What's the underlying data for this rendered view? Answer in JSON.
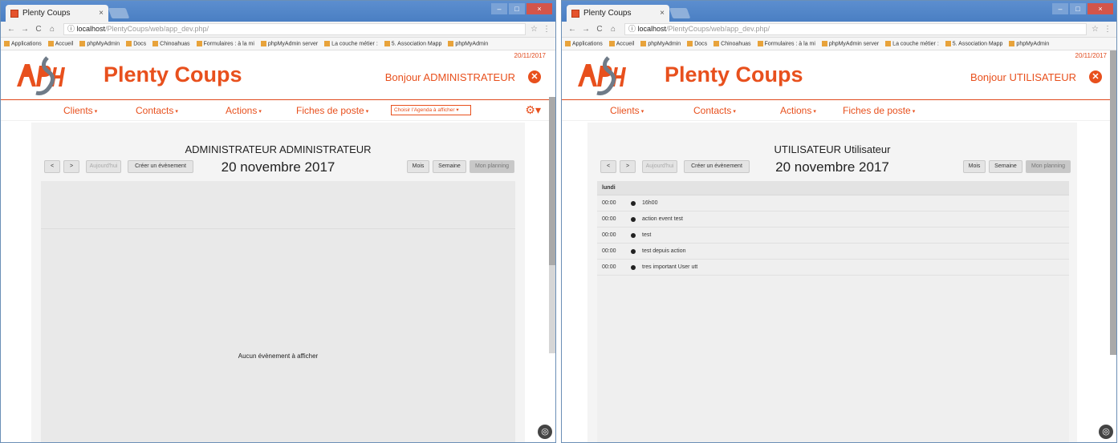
{
  "windows": [
    {
      "browser": {
        "tab_title": "Plenty Coups",
        "tab_close": "×",
        "url_host": "localhost",
        "url_path": "/PlentyCoups/web/app_dev.php/",
        "controls": [
          "–",
          "□",
          "×"
        ],
        "bookmarks": [
          "Applications",
          "Accueil",
          "phpMyAdmin",
          "Docs",
          "Chinoahuas",
          "Formulaires : à la mi",
          "phpMyAdmin server",
          "La couche métier :",
          "5. Association Mapp",
          "phpMyAdmin"
        ]
      },
      "site": {
        "date": "20/11/2017",
        "brand": "Plenty Coups",
        "greeting": "Bonjour ADMINISTRATEUR",
        "menu": [
          "Clients",
          "Contacts",
          "Actions",
          "Fiches de poste"
        ],
        "agenda_select": "Choisir l'Agenda à afficher ▾",
        "user_name": "ADMINISTRATEUR ADMINISTRATEUR",
        "date_label": "20 novembre 2017",
        "buttons": {
          "prev": "<",
          "next": ">",
          "today": "Aujourd'hui",
          "create": "Créer un évènement",
          "month": "Mois",
          "week": "Semaine",
          "planning": "Mon planning"
        },
        "empty_message": "Aucun évènement à afficher"
      }
    },
    {
      "browser": {
        "tab_title": "Plenty Coups",
        "tab_close": "×",
        "url_host": "localhost",
        "url_path": "/PlentyCoups/web/app_dev.php/",
        "controls": [
          "–",
          "□",
          "×"
        ],
        "bookmarks": [
          "Applications",
          "Accueil",
          "phpMyAdmin",
          "Docs",
          "Chinoahuas",
          "Formulaires : à la mi",
          "phpMyAdmin server",
          "La couche métier :",
          "5. Association Mapp",
          "phpMyAdmin"
        ]
      },
      "site": {
        "date": "20/11/2017",
        "brand": "Plenty Coups",
        "greeting": "Bonjour UTILISATEUR",
        "menu": [
          "Clients",
          "Contacts",
          "Actions",
          "Fiches de poste"
        ],
        "user_name": "UTILISATEUR Utilisateur",
        "date_label": "20 novembre 2017",
        "buttons": {
          "prev": "<",
          "next": ">",
          "today": "Aujourd'hui",
          "create": "Créer un évènement",
          "month": "Mois",
          "week": "Semaine",
          "planning": "Mon planning"
        },
        "list_day": "lundi",
        "events": [
          {
            "time": "00:00",
            "title": "16h00"
          },
          {
            "time": "00:00",
            "title": "action event test"
          },
          {
            "time": "00:00",
            "title": "test"
          },
          {
            "time": "00:00",
            "title": "test depuis action"
          },
          {
            "time": "00:00",
            "title": "tres important User utt"
          }
        ]
      }
    }
  ],
  "colors": {
    "brand": "#e8501d",
    "titlebar": "#4a7fc3"
  }
}
